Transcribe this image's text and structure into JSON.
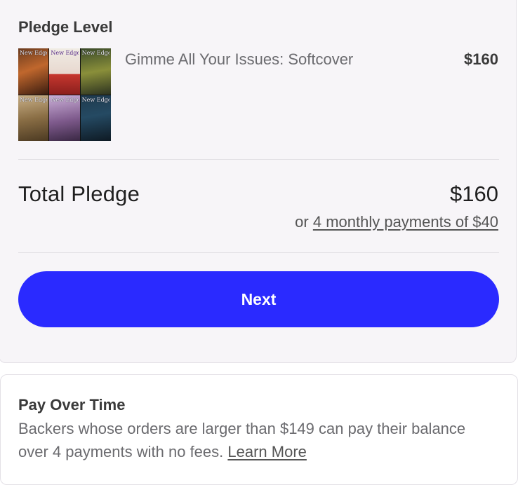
{
  "pledge": {
    "section_label": "Pledge Level",
    "item_title": "Gimme All Your Issues: Softcover",
    "item_price": "$160",
    "thumbnail": {
      "masthead_text": "New Edge",
      "tiles": 6
    }
  },
  "total": {
    "label": "Total Pledge",
    "amount": "$160",
    "installments_prefix": "or",
    "installments_link": "4 monthly payments of $40"
  },
  "actions": {
    "next_label": "Next"
  },
  "pay_over_time": {
    "title": "Pay Over Time",
    "body": "Backers whose orders are larger than $149 can pay their balance over 4 payments with no fees.",
    "link_label": "Learn More"
  },
  "colors": {
    "accent": "#2a2aff",
    "card_background": "#f7f5f8",
    "text_muted": "#6b6b6f"
  }
}
